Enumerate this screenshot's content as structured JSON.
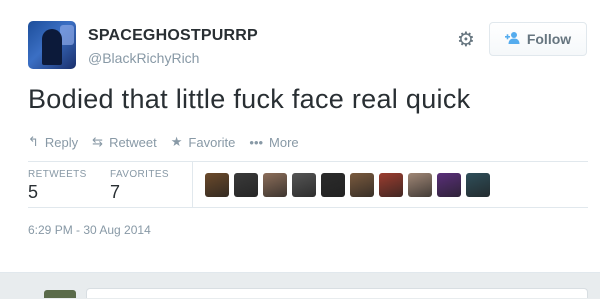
{
  "tweet": {
    "fullname": "SPACEGHOSTPURRP",
    "username": "@BlackRichyRich",
    "text": "Bodied that little fuck face real quick",
    "timestamp": "6:29 PM - 30 Aug 2014"
  },
  "follow_button": {
    "label": "Follow",
    "icon": "add-user-icon"
  },
  "settings": {
    "icon": "gear-icon"
  },
  "actions": [
    {
      "label": "Reply",
      "icon": "reply-icon"
    },
    {
      "label": "Retweet",
      "icon": "retweet-icon"
    },
    {
      "label": "Favorite",
      "icon": "star-icon"
    },
    {
      "label": "More",
      "icon": "more-dots-icon"
    }
  ],
  "stats": {
    "retweets": {
      "label": "RETWEETS",
      "value": "5"
    },
    "favorites": {
      "label": "FAVORITES",
      "value": "7"
    }
  },
  "favoriters": [
    {
      "color": "#6b4a2b"
    },
    {
      "color": "#3a3a3a"
    },
    {
      "color": "#8c6e5a"
    },
    {
      "color": "#555555"
    },
    {
      "color": "#2b2b2b"
    },
    {
      "color": "#7a5a3e"
    },
    {
      "color": "#9c3d2f"
    },
    {
      "color": "#a08776"
    },
    {
      "color": "#5a2f7a"
    },
    {
      "color": "#2f4f5a"
    }
  ],
  "colors": {
    "accent": "#55acee",
    "text": "#292f33",
    "muted": "#8899a6",
    "reply_bar": "#e8ecee"
  }
}
